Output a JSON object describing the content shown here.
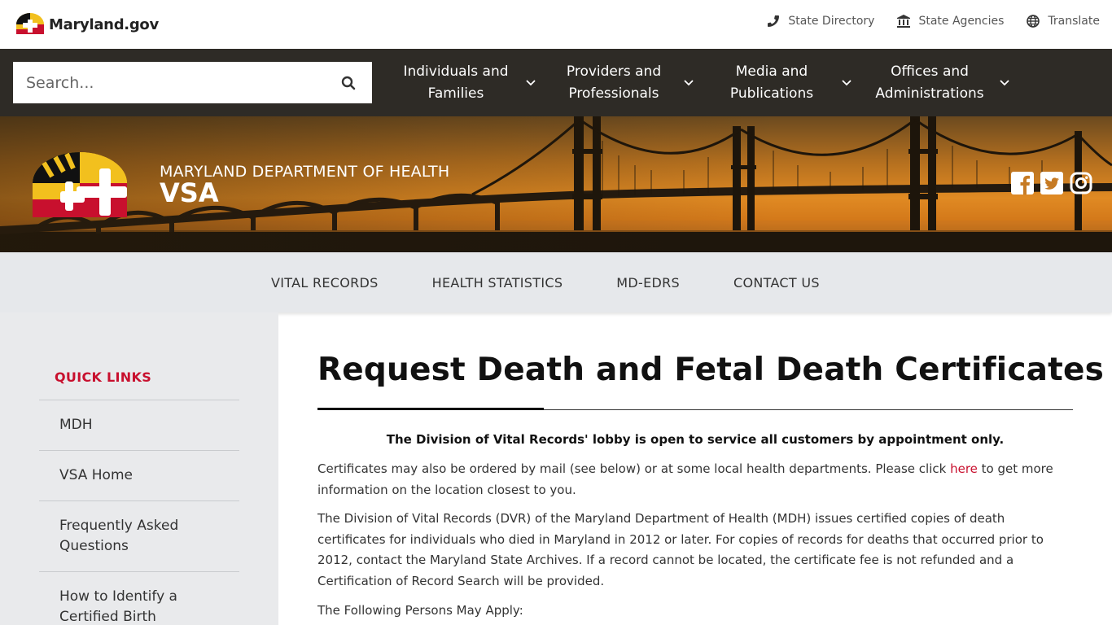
{
  "utility": {
    "logo_text": "Maryland.gov",
    "links": [
      {
        "label": "State Directory",
        "icon": "phone-icon"
      },
      {
        "label": "State Agencies",
        "icon": "building-icon"
      },
      {
        "label": "Translate",
        "icon": "globe-icon"
      }
    ]
  },
  "nav": {
    "search_placeholder": "Search...",
    "items": [
      {
        "label": "Individuals and\nFamilies"
      },
      {
        "label": "Providers and\nProfessionals"
      },
      {
        "label": "Media and\nPublications"
      },
      {
        "label": "Offices and\nAdministrations"
      }
    ]
  },
  "banner": {
    "department": "MARYLAND DEPARTMENT OF HEALTH",
    "agency": "VSA",
    "social": [
      "facebook-icon",
      "twitter-icon",
      "instagram-icon"
    ]
  },
  "subnav": {
    "items": [
      "VITAL RECORDS",
      "HEALTH STATISTICS",
      "MD-EDRS",
      "CONTACT US"
    ]
  },
  "sidebar": {
    "title": "QUICK LINKS",
    "items": [
      "MDH",
      "VSA Home",
      "Frequently Asked Questions",
      "How to Identify a Certified Birth"
    ]
  },
  "content": {
    "title": "Request Death and Fetal Death Certificates",
    "notice": "The Division of Vital Records' lobby is open to service all customers by appointment only.",
    "p1_before": "Certificates may also be ordered by mail (see below) or at some local health departments. Please click ",
    "p1_link": "here",
    "p1_after": " to get more information on the location closest to you.",
    "p2": "The Division of Vital Records (DVR) of the Maryland Department of Health (MDH) issues certified copies of death certificates for individuals who died in Maryland in 2012 or later. For copies of records for deaths that occurred prior to 2012, contact the Maryland State Archives. If a record cannot be located, the certificate fee is not refunded and a Certification of Record Search will be provided.",
    "p3": "The Following Persons May Apply:"
  },
  "colors": {
    "accent_red": "#c8102e",
    "nav_bg": "#2e2b26",
    "subnav_bg": "#e6e8eb",
    "flag_gold": "#f2c01e"
  }
}
